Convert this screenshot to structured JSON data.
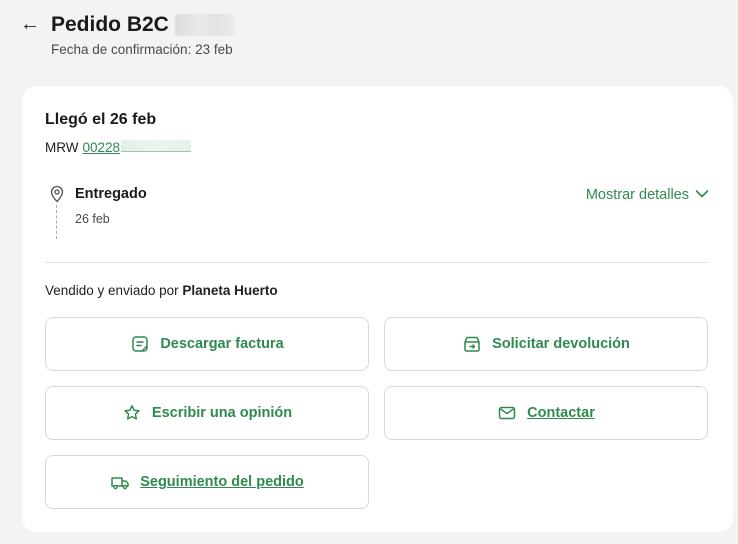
{
  "header": {
    "back_label": "←",
    "title": "Pedido B2C",
    "subtitle": "Fecha de confirmación: 23 feb"
  },
  "shipment": {
    "arrival": "Llegó el 26 feb",
    "carrier": "MRW",
    "tracking_visible": "00228",
    "status": "Entregado",
    "status_date": "26 feb",
    "details_toggle": "Mostrar detalles"
  },
  "seller": {
    "prefix": "Vendido y enviado por",
    "name": "Planeta Huerto"
  },
  "actions": {
    "download_invoice": "Descargar factura",
    "request_return": "Solicitar devolución",
    "write_review": "Escribir una opinión",
    "contact": "Contactar",
    "track_order": "Seguimiento del pedido"
  },
  "colors": {
    "accent": "#2f8a4f",
    "background": "#f3f3f2",
    "card": "#ffffff",
    "border": "#d8d8d8"
  },
  "icons": {
    "back": "arrow-left-icon",
    "status": "location-pin-icon",
    "toggle": "chevron-down-icon",
    "invoice": "receipt-icon",
    "return": "return-box-icon",
    "review": "star-icon",
    "contact": "envelope-icon",
    "tracking": "delivery-truck-icon"
  }
}
